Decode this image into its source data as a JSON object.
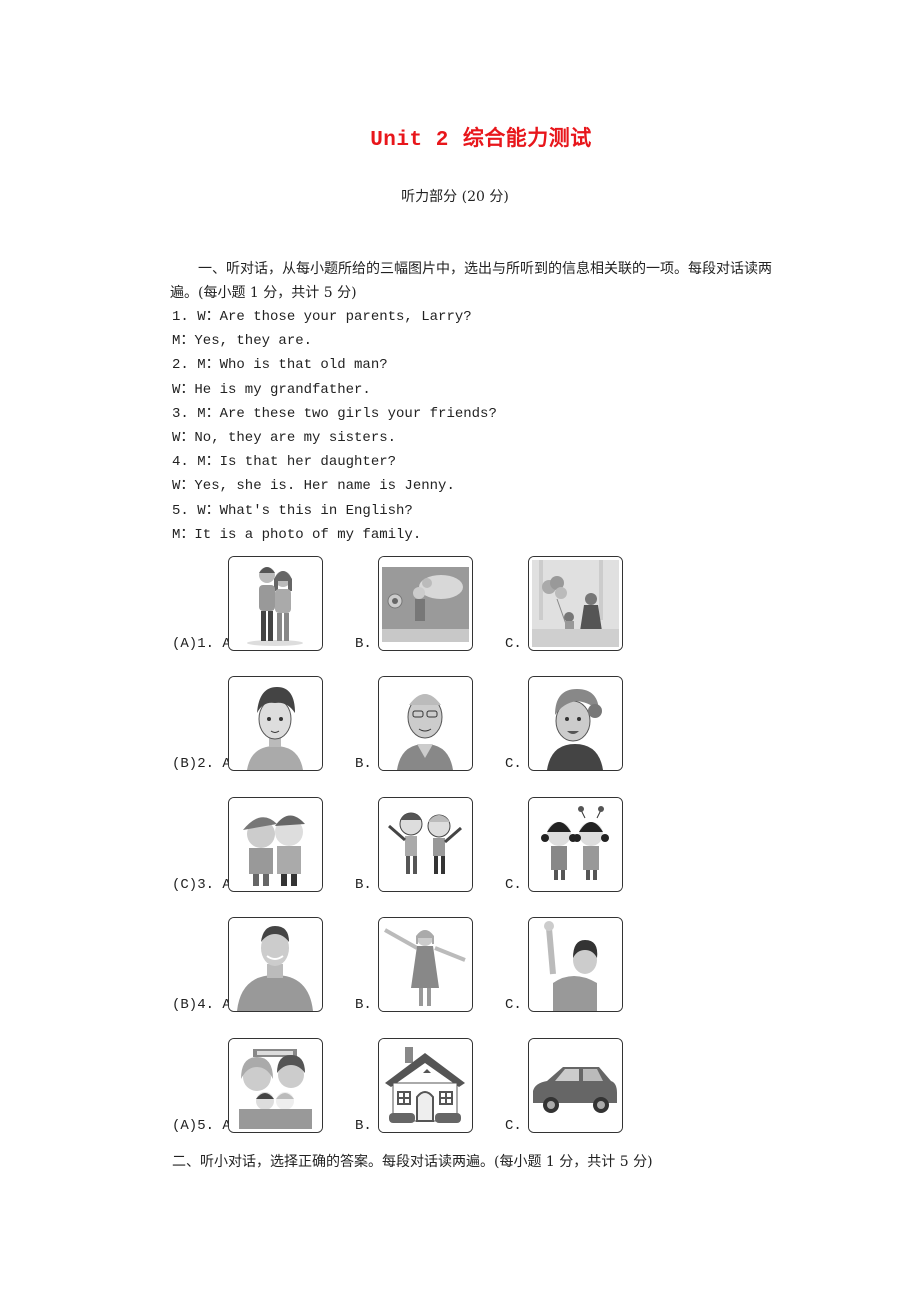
{
  "header": {
    "title_unit": "Unit 2",
    "title_cn": "综合能力测试",
    "subtitle": "听力部分 (20 分)"
  },
  "section1": {
    "instruction": "一、听对话，从每小题所给的三幅图片中，选出与所听到的信息相关联的一项。每段对话读两遍。(每小题 1 分，共计 5 分)",
    "dialogs": [
      "1. W：Are those your parents, Larry?",
      "M：Yes, they are.",
      "2. M：Who is that old man?",
      "W：He is my grandfather.",
      "3. M：Are these two girls your friends?",
      "W：No, they are my sisters.",
      "4. M：Is that her daughter?",
      "W：Yes, she is. Her name is Jenny.",
      "5. W：What's this in English?",
      "M：It is a photo of my family."
    ],
    "questions": [
      {
        "label": "(A)1. A.",
        "answer": "A",
        "options": [
          {
            "letter": "A.",
            "image": "couple-embracing-image"
          },
          {
            "letter": "B.",
            "image": "parent-child-outdoors-image"
          },
          {
            "letter": "C.",
            "image": "mother-daughter-balloons-image"
          }
        ]
      },
      {
        "label": "(B)2. A.",
        "answer": "B",
        "options": [
          {
            "letter": "A.",
            "image": "young-boy-portrait-image"
          },
          {
            "letter": "B.",
            "image": "old-man-glasses-image"
          },
          {
            "letter": "C.",
            "image": "old-woman-portrait-image"
          }
        ]
      },
      {
        "label": "(C)3. A.",
        "answer": "C",
        "options": [
          {
            "letter": "A.",
            "image": "two-boys-image"
          },
          {
            "letter": "B.",
            "image": "boy-and-girl-waving-image"
          },
          {
            "letter": "C.",
            "image": "two-girls-image"
          }
        ]
      },
      {
        "label": "(B)4. A.",
        "answer": "B",
        "options": [
          {
            "letter": "A.",
            "image": "smiling-man-image"
          },
          {
            "letter": "B.",
            "image": "little-girl-arms-open-image"
          },
          {
            "letter": "C.",
            "image": "boy-waving-image"
          }
        ]
      },
      {
        "label": "(A)5. A.",
        "answer": "A",
        "options": [
          {
            "letter": "A.",
            "image": "happy-family-photo-image"
          },
          {
            "letter": "B.",
            "image": "house-image"
          },
          {
            "letter": "C.",
            "image": "car-image"
          }
        ]
      }
    ]
  },
  "section2": {
    "instruction": "二、听小对话，选择正确的答案。每段对话读两遍。(每小题 1 分，共计 5 分)"
  },
  "colors": {
    "title": "#e8161b",
    "text": "#222222",
    "frame": "#333333"
  }
}
